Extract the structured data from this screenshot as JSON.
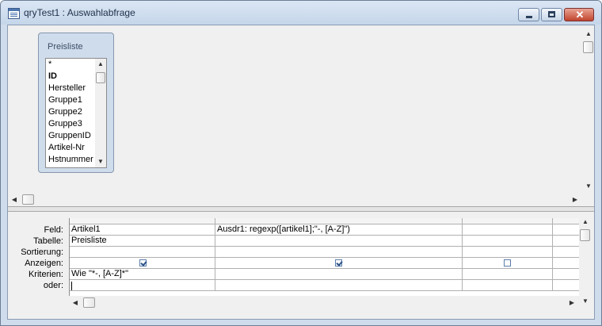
{
  "window": {
    "title": "qryTest1 : Auswahlabfrage"
  },
  "titlebar_buttons": {
    "minimize_icon": "minimize-icon",
    "maximize_icon": "maximize-icon",
    "close_icon": "close-icon",
    "close_glyph": "✕"
  },
  "table": {
    "title": "Preisliste",
    "fields": [
      "*",
      "ID",
      "Hersteller",
      "Gruppe1",
      "Gruppe2",
      "Gruppe3",
      "GruppenID",
      "Artikel-Nr",
      "Hstnummer"
    ]
  },
  "grid": {
    "row_labels": [
      "Feld:",
      "Tabelle:",
      "Sortierung:",
      "Anzeigen:",
      "Kriterien:",
      "oder:"
    ],
    "columns": [
      {
        "feld": "Artikel1",
        "tabelle": "Preisliste",
        "sortierung": "",
        "anzeigen": true,
        "kriterien": "Wie \"*-, [A-Z]*\"",
        "oder": ""
      },
      {
        "feld": "Ausdr1: regexp([artikel1];\"-, [A-Z]\")",
        "tabelle": "",
        "sortierung": "",
        "anzeigen": true,
        "kriterien": "",
        "oder": ""
      },
      {
        "feld": "",
        "tabelle": "",
        "sortierung": "",
        "anzeigen": false,
        "kriterien": "",
        "oder": ""
      }
    ]
  },
  "colors": {
    "accent": "#cfdcec",
    "close": "#c1442e"
  }
}
